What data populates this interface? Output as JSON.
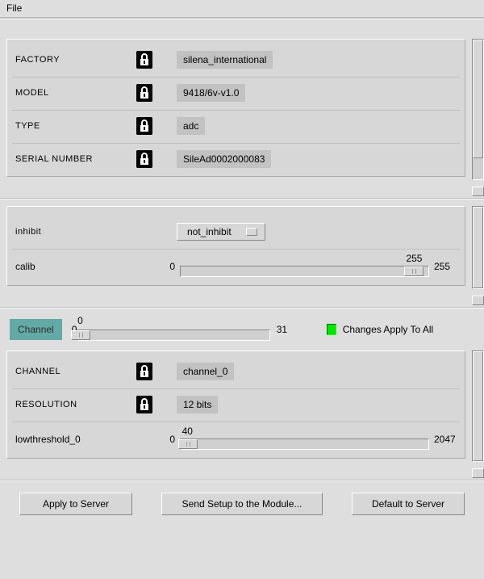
{
  "menu": {
    "file": "File"
  },
  "identity": {
    "factory": {
      "label": "FACTORY",
      "value": "silena_international"
    },
    "model": {
      "label": "MODEL",
      "value": "9418/6v-v1.0"
    },
    "type": {
      "label": "TYPE",
      "value": "adc"
    },
    "serial": {
      "label": "SERIAL NUMBER",
      "value": "SileAd0002000083"
    }
  },
  "controls": {
    "inhibit": {
      "label": "inhibit",
      "value": "not_inhibit"
    },
    "calib": {
      "label": "calib",
      "min": "0",
      "value": "255",
      "max": "255",
      "thumb_pct": 94
    }
  },
  "channel_strip": {
    "chip": "Channel",
    "min": "0",
    "value": "0",
    "max": "31",
    "thumb_pct": 2,
    "led_label": "Changes Apply To All"
  },
  "channel_detail": {
    "channel": {
      "label": "CHANNEL",
      "value": "channel_0"
    },
    "resolution": {
      "label": "RESOLUTION",
      "value": "12 bits"
    },
    "lowthreshold": {
      "label": "lowthreshold_0",
      "min": "0",
      "value": "40",
      "max": "2047",
      "thumb_pct": 3
    }
  },
  "buttons": {
    "apply": "Apply to Server",
    "send": "Send Setup to the Module...",
    "default": "Default to Server"
  }
}
